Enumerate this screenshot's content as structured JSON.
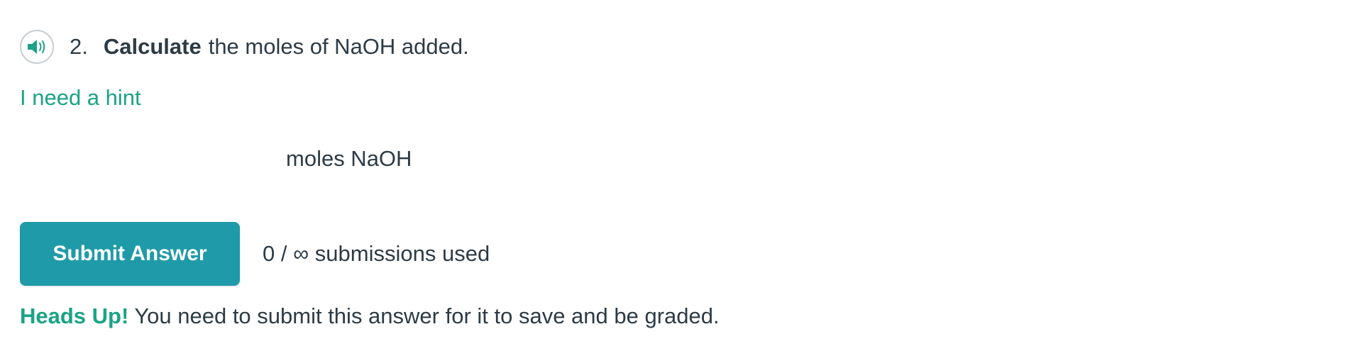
{
  "question": {
    "speaker_icon": "speaker-volume-icon",
    "number": "2.",
    "bold_text": "Calculate",
    "rest_text": "the moles of NaOH added."
  },
  "hint": {
    "label": "I need a hint"
  },
  "answer": {
    "value": "",
    "placeholder": "",
    "unit": "moles NaOH"
  },
  "submit": {
    "label": "Submit Answer",
    "submissions_text": "0 / ∞ submissions used"
  },
  "heads_up": {
    "strong": "Heads Up!",
    "text": "You need to submit this answer for it to save and be graded."
  },
  "colors": {
    "accent_green": "#1aa386",
    "button_teal": "#1f9aa8",
    "text": "#2d3b45"
  }
}
